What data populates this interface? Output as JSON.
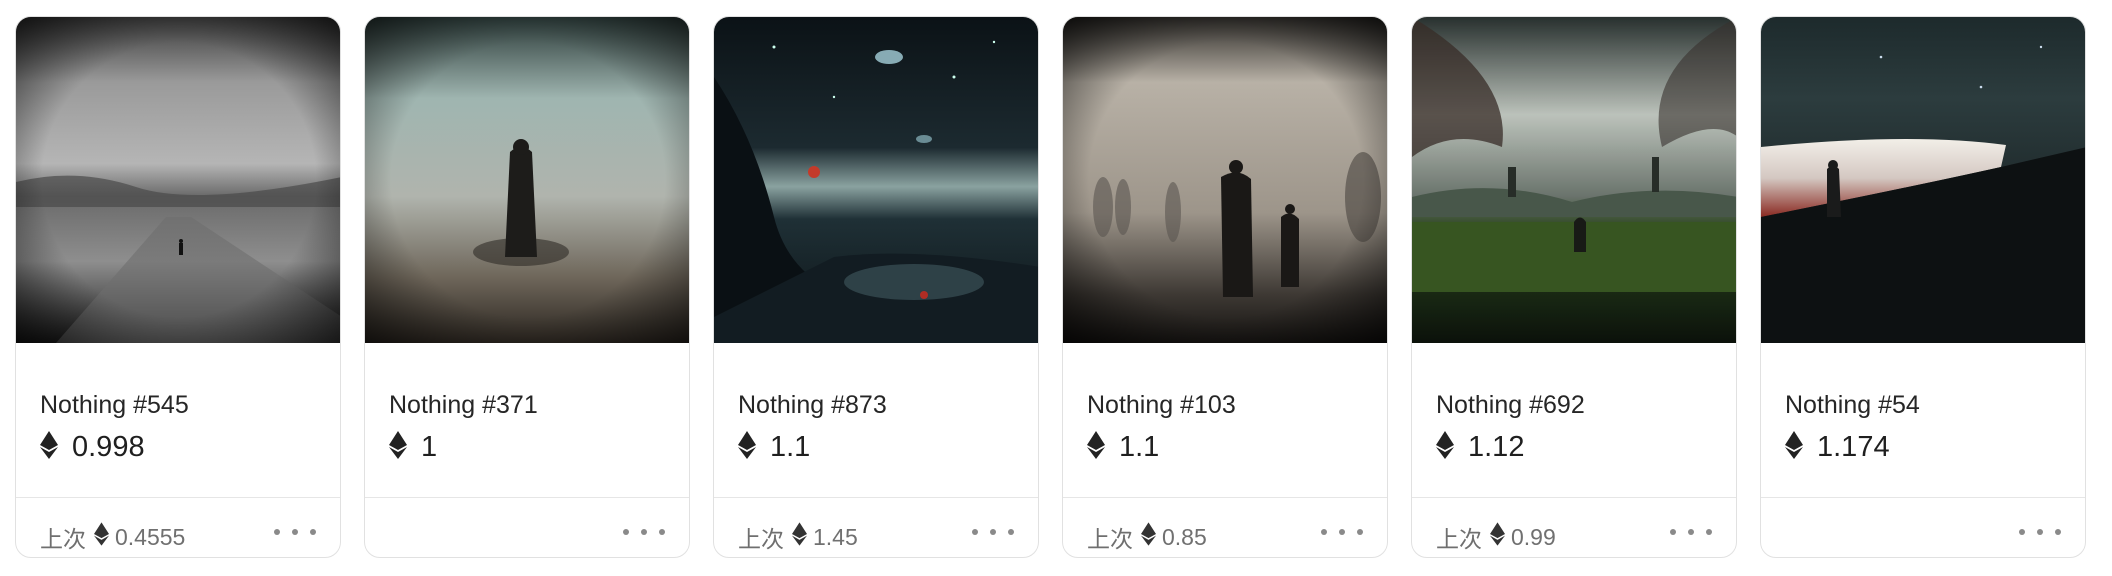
{
  "cards": [
    {
      "title": "Nothing #545",
      "price": "0.998",
      "last_label": "上次",
      "last_price": "0.4555"
    },
    {
      "title": "Nothing #371",
      "price": "1",
      "last_label": "",
      "last_price": ""
    },
    {
      "title": "Nothing #873",
      "price": "1.1",
      "last_label": "上次",
      "last_price": "1.45"
    },
    {
      "title": "Nothing #103",
      "price": "1.1",
      "last_label": "上次",
      "last_price": "0.85"
    },
    {
      "title": "Nothing #692",
      "price": "1.12",
      "last_label": "上次",
      "last_price": "0.99"
    },
    {
      "title": "Nothing #54",
      "price": "1.174",
      "last_label": "",
      "last_price": ""
    }
  ],
  "icons": {
    "currency": "ethereum-icon",
    "more": "more-options-icon"
  },
  "colors": {
    "text": "#262626",
    "muted": "#707070",
    "border": "#e1e1e1"
  }
}
